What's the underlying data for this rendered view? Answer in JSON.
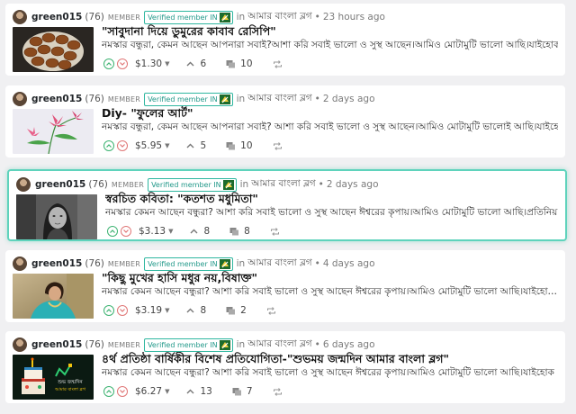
{
  "posts": [
    {
      "author": "green015",
      "reputation": "(76)",
      "member_label": "MEMBER",
      "badge": "Verified member IN",
      "in_label": "in",
      "community": "আমার বাংলা ব্লগ",
      "separator": "•",
      "time": "23 hours ago",
      "title": "\"সাবুদানা দিয়ে ডুমুরের কাবাব রেসিপি\"",
      "excerpt": "নমস্কার বন্ধুরা, কেমন আছেন আপনারা সবাই?আশা করি সবাই ভালো ও সুস্থ আছেন।আমিও মোটামুটি ভালো আছি।যাইহোক…",
      "payout": "$1.30",
      "votes": "6",
      "comments": "10",
      "thumb": "kabab"
    },
    {
      "author": "green015",
      "reputation": "(76)",
      "member_label": "MEMBER",
      "badge": "Verified member IN",
      "in_label": "in",
      "community": "আমার বাংলা ব্লগ",
      "separator": "•",
      "time": "2 days ago",
      "title": "Diy- \"ফুলের আর্ট\"",
      "excerpt": "নমস্কার বন্ধুরা, কেমন আছেন আপনারা সবাই? আশা করি সবাই ভালো ও সুস্থ আছেন।আমিও মোটামুটি ভালোই আছি।যাইহো…",
      "payout": "$5.95",
      "votes": "5",
      "comments": "10",
      "thumb": "flower"
    },
    {
      "author": "green015",
      "reputation": "(76)",
      "member_label": "MEMBER",
      "badge": "Verified member IN",
      "in_label": "in",
      "community": "আমার বাংলা ব্লগ",
      "separator": "•",
      "time": "2 days ago",
      "title": "স্বরচিত কবিতা: \"কতশত মধুমিতা\"",
      "excerpt": "নমস্কার কেমন আছেন বন্ধুরা? আশা করি সবাই ভালো ও সুস্থ আছেন ঈশ্বরের কৃপায়।আমিও মোটামুটি ভালো আছি।প্রতিনিয়…",
      "payout": "$3.13",
      "votes": "8",
      "comments": "8",
      "thumb": "portrait"
    },
    {
      "author": "green015",
      "reputation": "(76)",
      "member_label": "MEMBER",
      "badge": "Verified member IN",
      "in_label": "in",
      "community": "আমার বাংলা ব্লগ",
      "separator": "•",
      "time": "4 days ago",
      "title": "\"কিছু মুখের হাসি মধুর নয়,বিষাক্ত\"",
      "excerpt": "নমস্কার কেমন আছেন বন্ধুরা? আশা করি সবাই ভালো ও সুস্থ আছেন ঈশ্বরের কৃপায়।আমিও মোটামুটি ভালো আছি।যাইহো…",
      "payout": "$3.19",
      "votes": "8",
      "comments": "2",
      "thumb": "woman"
    },
    {
      "author": "green015",
      "reputation": "(76)",
      "member_label": "MEMBER",
      "badge": "Verified member IN",
      "in_label": "in",
      "community": "আমার বাংলা ব্লগ",
      "separator": "•",
      "time": "6 days ago",
      "title": "৪র্থ প্রতিষ্ঠা বার্ষিকীর বিশেষ প্রতিযোগিতা-\"শুভময় জন্মদিন আমার বাংলা ব্লগ\"",
      "excerpt": "নমস্কার কেমন আছেন বন্ধুরা? আশা করি সবাই ভালো ও সুস্থ আছেন ঈশ্বরের কৃপায়।আমিও মোটামুটি ভালো আছি।যাইহোক …",
      "payout": "$6.27",
      "votes": "13",
      "comments": "7",
      "thumb": "cake",
      "thumb_caption_1": "শুভ জন্মদিন",
      "thumb_caption_2": "আমার বাংলা ব্লগ"
    }
  ],
  "icons": {
    "upvote": "chevron-up-icon",
    "downvote": "chevron-down-icon",
    "votes": "chevron-up-icon",
    "comments": "comments-icon",
    "reblog": "reblog-icon",
    "badge": "community-badge-icon"
  },
  "colors": {
    "highlight": "#5fd3bc",
    "badge": "#2fb7a0",
    "upvote": "#3cb371",
    "downvote": "#e07777"
  }
}
